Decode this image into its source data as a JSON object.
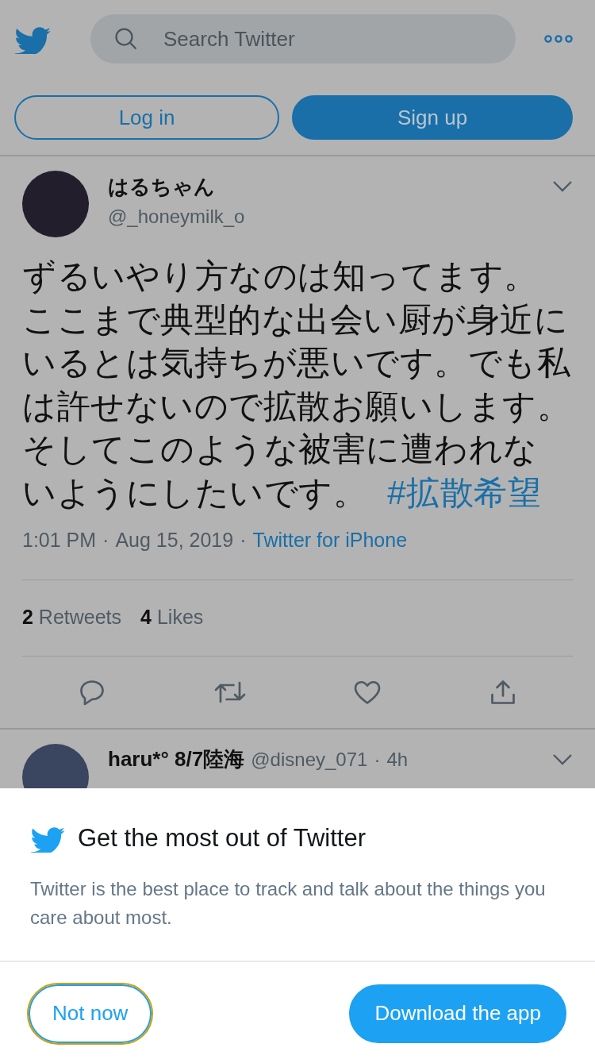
{
  "header": {
    "search": {
      "placeholder": "Search Twitter"
    },
    "buttons": [
      {
        "label": "Log in",
        "kind": "outline"
      },
      {
        "label": "Sign up",
        "kind": "filled"
      }
    ]
  },
  "tweet": {
    "author": {
      "name": "はるちゃん",
      "handle": "@_honeymilk_o"
    },
    "text_lines": [
      "ずるいやり方なのは知ってます。",
      "ここまで典型的な出会い厨が身近に",
      "いるとは気持ちが悪いです。でも私",
      "は許せないので拡散お願いします。",
      "そしてこのような被害に遭われな",
      "いようにしたいです。"
    ],
    "hashtag": "#拡散希望",
    "separator": "·",
    "time": "1:01 PM",
    "date": "Aug 15, 2019",
    "source": "Twitter for iPhone",
    "stats": [
      {
        "count": "2",
        "label": "Retweets"
      },
      {
        "count": "4",
        "label": "Likes"
      }
    ]
  },
  "reply": {
    "name": "haru*° 8/7陸海",
    "handle": "@disney_071",
    "separator": "·",
    "time": "4h"
  },
  "prompt": {
    "title": "Get the most out of Twitter",
    "body": "Twitter is the best place to track and talk about the things you care about most.",
    "buttons": [
      {
        "label": "Not now",
        "kind": "outline",
        "focused": true
      },
      {
        "label": "Download the app",
        "kind": "filled",
        "focused": false
      }
    ]
  }
}
